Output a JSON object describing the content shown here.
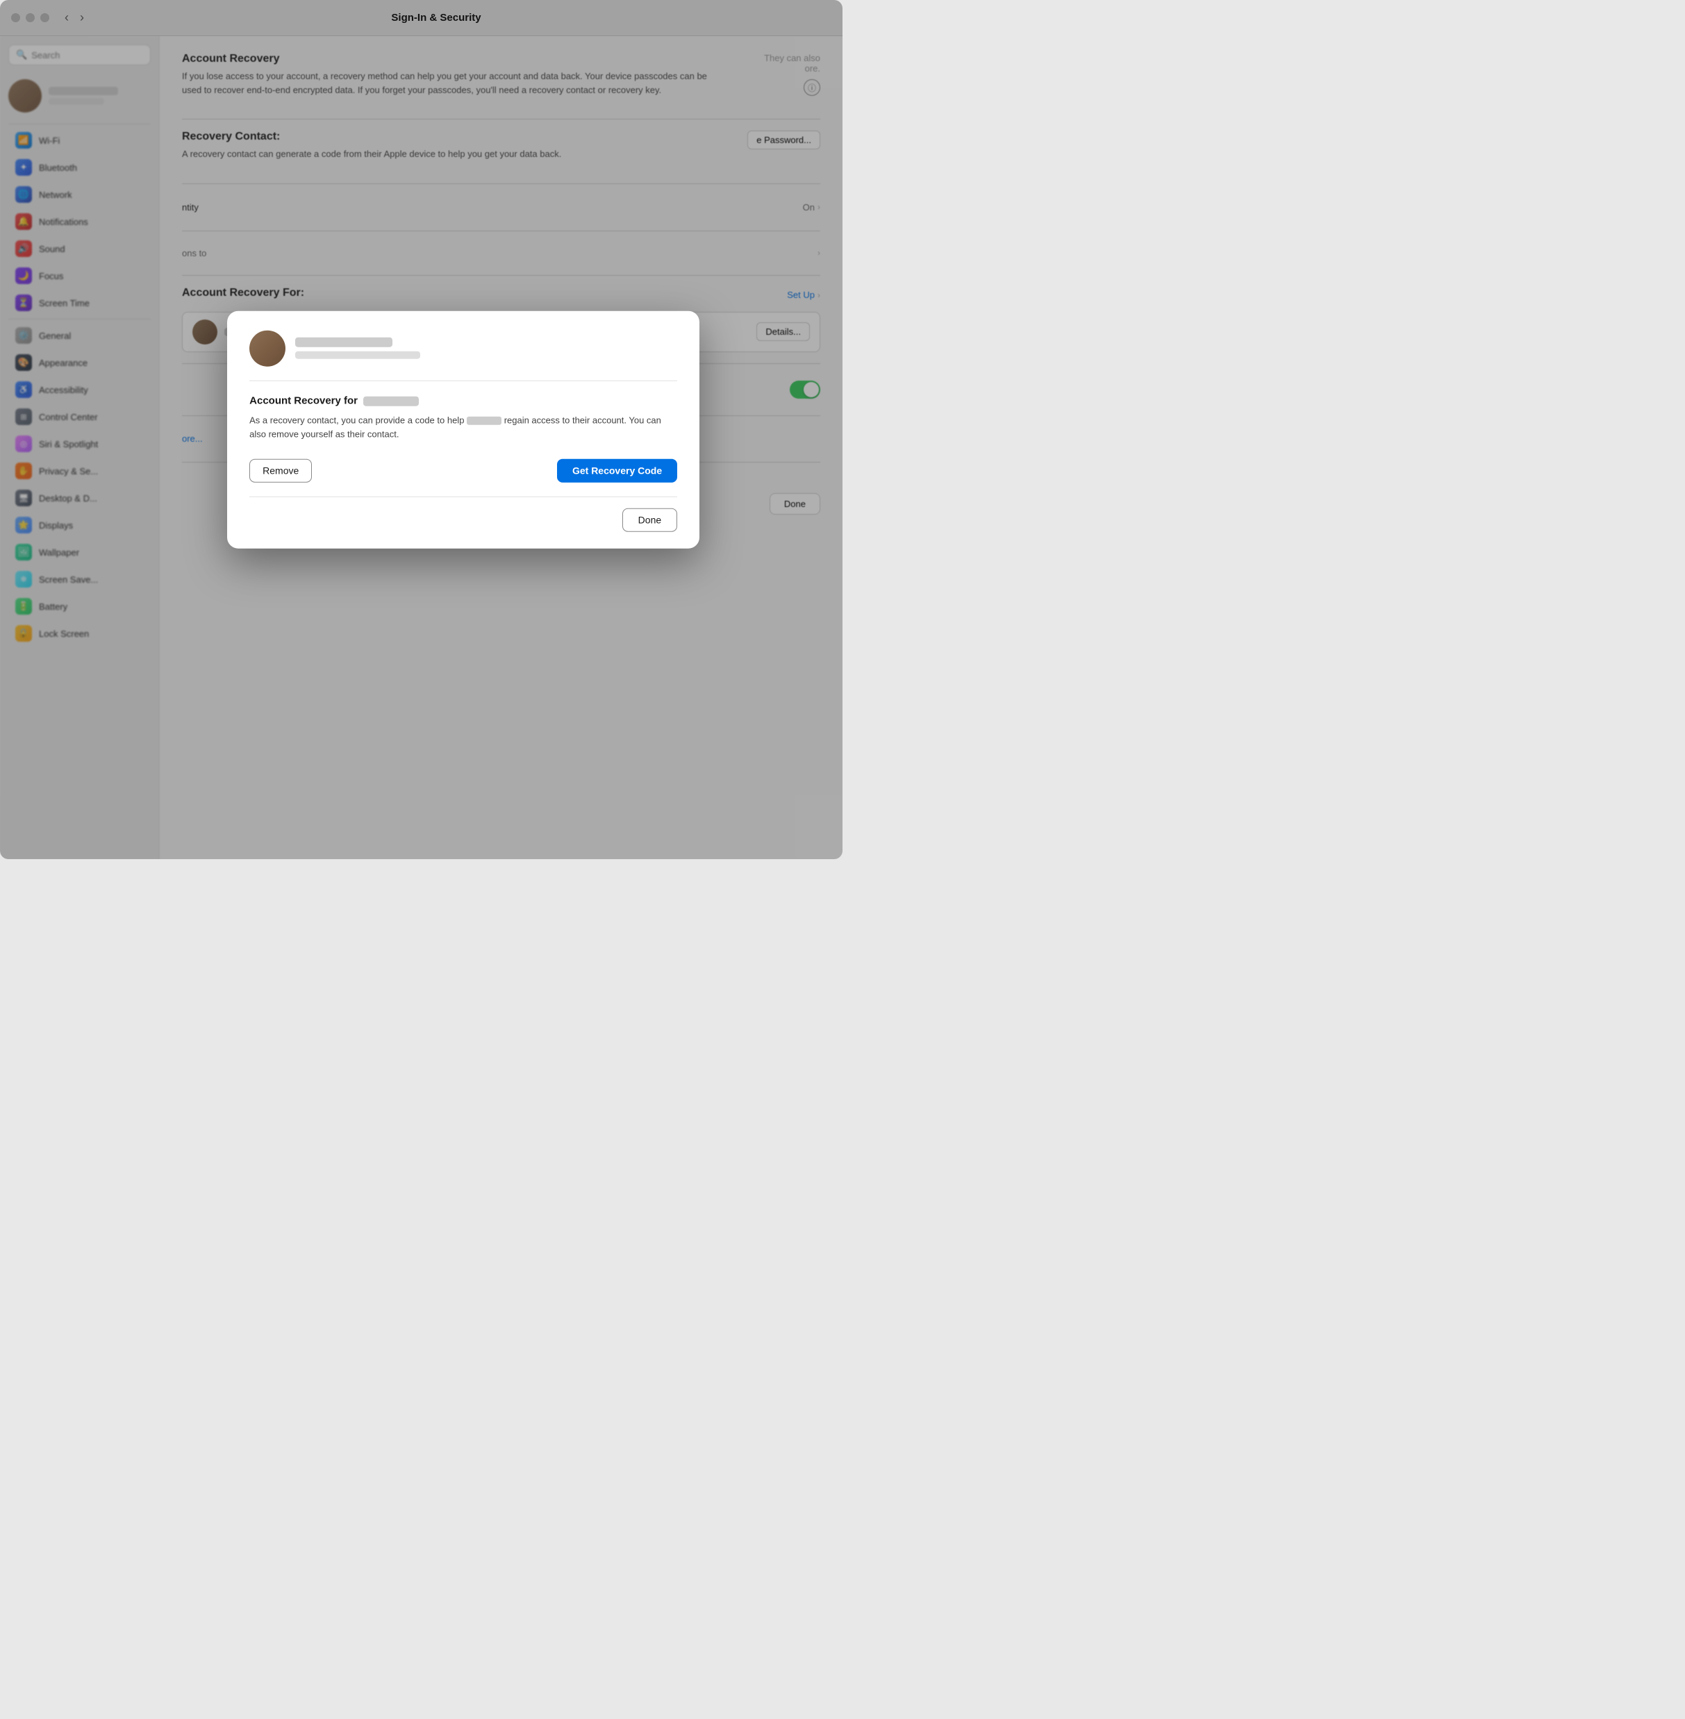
{
  "window": {
    "title": "Sign-In & Security",
    "traffic_lights": [
      "close",
      "minimize",
      "zoom"
    ]
  },
  "sidebar": {
    "search": {
      "placeholder": "Search"
    },
    "user": {
      "name_redacted": true,
      "sub_redacted": true
    },
    "items": [
      {
        "id": "wifi",
        "label": "Wi-Fi",
        "icon": "wifi"
      },
      {
        "id": "bluetooth",
        "label": "Bluetooth",
        "icon": "bluetooth"
      },
      {
        "id": "network",
        "label": "Network",
        "icon": "network"
      },
      {
        "id": "notifications",
        "label": "Notifications",
        "icon": "notifications"
      },
      {
        "id": "sound",
        "label": "Sound",
        "icon": "sound"
      },
      {
        "id": "focus",
        "label": "Focus",
        "icon": "focus"
      },
      {
        "id": "screentime",
        "label": "Screen Time",
        "icon": "screentime"
      },
      {
        "id": "general",
        "label": "General",
        "icon": "general"
      },
      {
        "id": "appearance",
        "label": "Appearance",
        "icon": "appearance"
      },
      {
        "id": "accessibility",
        "label": "Accessibility",
        "icon": "accessibility"
      },
      {
        "id": "controlcenter",
        "label": "Control Center",
        "icon": "controlcenter"
      },
      {
        "id": "siri",
        "label": "Siri & Spotlight",
        "icon": "siri"
      },
      {
        "id": "privacy",
        "label": "Privacy & Se...",
        "icon": "privacy"
      },
      {
        "id": "desktop",
        "label": "Desktop & D...",
        "icon": "desktop"
      },
      {
        "id": "displays",
        "label": "Displays",
        "icon": "displays"
      },
      {
        "id": "wallpaper",
        "label": "Wallpaper",
        "icon": "wallpaper"
      },
      {
        "id": "screensaver",
        "label": "Screen Save...",
        "icon": "screensaver"
      },
      {
        "id": "battery",
        "label": "Battery",
        "icon": "battery"
      },
      {
        "id": "lock",
        "label": "Lock Screen",
        "icon": "lock"
      }
    ]
  },
  "main": {
    "account_recovery": {
      "title": "Account Recovery",
      "description": "If you lose access to your account, a recovery method can help you get your account and data back. Your device passcodes can be used to recover end-to-end encrypted data. If you forget your passcodes, you'll need a recovery contact or recovery key."
    },
    "right_partial": "They can also\nore.",
    "recovery_contact": {
      "title": "Recovery Contact:",
      "description": "A recovery contact can generate a code from their Apple device to help you get your data back."
    },
    "change_password_btn": "e Password...",
    "row1_label": "ntity",
    "row1_value": "On",
    "row2_partial_right": "ons to",
    "recovery_for_section": {
      "title": "Account Recovery For:",
      "details_btn": "Details...",
      "set_up": "Set Up"
    },
    "toggle_on": true,
    "learn_more": "ore...",
    "done_bottom": "Done"
  },
  "modal": {
    "contact_name_redacted": true,
    "contact_email_redacted": true,
    "section_title_prefix": "Account Recovery for",
    "section_title_name_redacted": true,
    "description_prefix": "As a recovery contact, you can provide a code to help",
    "description_name_redacted": true,
    "description_suffix": "regain access to their account. You can also remove yourself as their contact.",
    "remove_label": "Remove",
    "get_recovery_code_label": "Get Recovery Code",
    "done_label": "Done"
  }
}
